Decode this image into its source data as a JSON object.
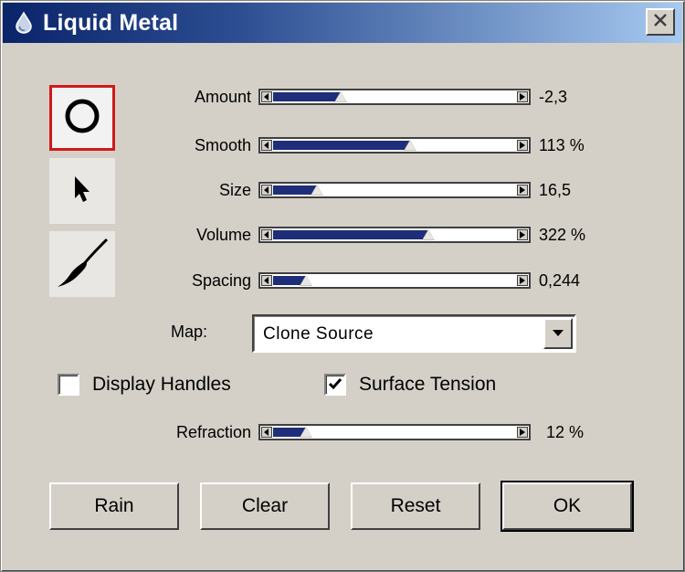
{
  "window": {
    "title": "Liquid Metal",
    "icons": {
      "app": "liquid-drop-icon",
      "close": "close-icon"
    }
  },
  "tools": [
    {
      "name": "circle-tool",
      "icon": "circle-icon",
      "selected": true
    },
    {
      "name": "pointer-tool",
      "icon": "arrow-pointer-icon",
      "selected": false
    },
    {
      "name": "brush-tool",
      "icon": "brush-icon",
      "selected": false
    }
  ],
  "sliders": [
    {
      "label": "Amount",
      "value": "-2,3",
      "position": 0.29
    },
    {
      "label": "Smooth",
      "value": "113 %",
      "position": 0.57
    },
    {
      "label": "Size",
      "value": "16,5",
      "position": 0.21
    },
    {
      "label": "Volume",
      "value": "322 %",
      "position": 0.64
    },
    {
      "label": "Spacing",
      "value": "0,244",
      "position": 0.17
    }
  ],
  "map": {
    "label": "Map:",
    "value": "Clone Source"
  },
  "checkboxes": {
    "display_handles": {
      "label": "Display Handles",
      "checked": false
    },
    "surface_tension": {
      "label": "Surface Tension",
      "checked": true
    }
  },
  "refraction": {
    "label": "Refraction",
    "value": "12 %",
    "position": 0.17
  },
  "buttons": {
    "rain": "Rain",
    "clear": "Clear",
    "reset": "Reset",
    "ok": "OK"
  },
  "colors": {
    "slider_fill": "#1f2e78",
    "title_start": "#0a246a",
    "title_end": "#a6caf0",
    "selected_tool_border": "#d01818"
  }
}
